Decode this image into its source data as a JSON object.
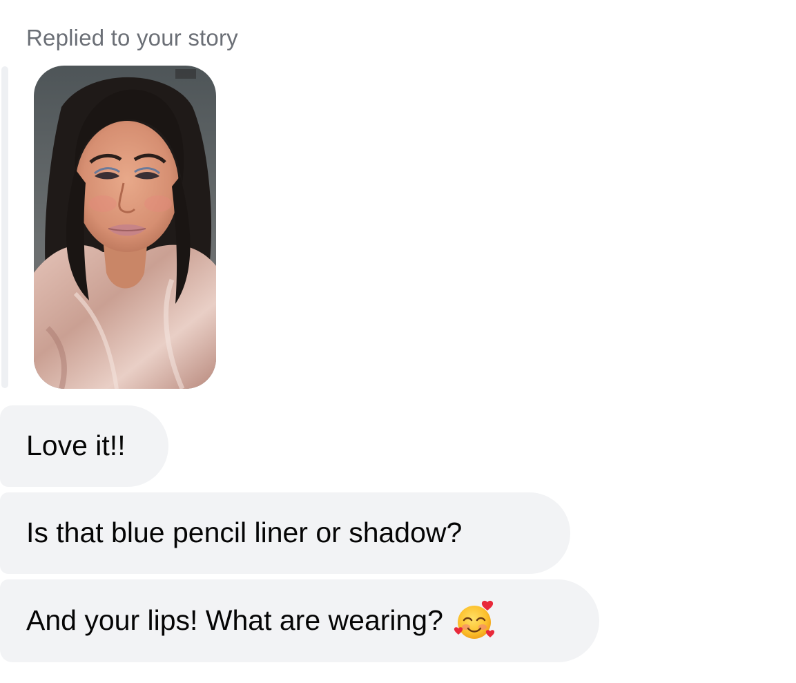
{
  "reply_header": {
    "label": "Replied to your story"
  },
  "story": {
    "thumbnail_icon": "story-photo-thumbnail"
  },
  "messages": [
    {
      "text": "Love it!!"
    },
    {
      "text": "Is that blue pencil liner or shadow?"
    },
    {
      "text": "And your lips! What are wearing?",
      "emoji_icon": "smiling-face-with-hearts-icon"
    }
  ],
  "colors": {
    "bubble_bg": "#f2f3f5",
    "label_text": "#6b6f76",
    "message_text": "#050505",
    "quote_bar": "#eef0f3"
  }
}
